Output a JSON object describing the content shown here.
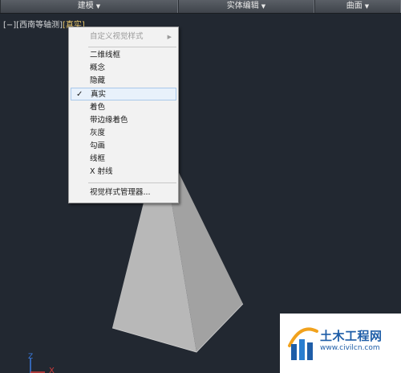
{
  "ribbon": {
    "tabs": [
      {
        "label": "建模",
        "arrow": "▼"
      },
      {
        "label": "实体编辑",
        "arrow": "▼"
      },
      {
        "label": "曲面",
        "arrow": "▼"
      }
    ]
  },
  "viewport": {
    "controls": "[−]",
    "view": "[西南等轴测]",
    "visual_style": "[真实]"
  },
  "context_menu": {
    "submenu_item": {
      "label": "自定义视觉样式",
      "arrow": "▶"
    },
    "styles": [
      {
        "label": "二维线框",
        "checked": false
      },
      {
        "label": "概念",
        "checked": false
      },
      {
        "label": "隐藏",
        "checked": false
      },
      {
        "label": "真实",
        "checked": true
      },
      {
        "label": "着色",
        "checked": false
      },
      {
        "label": "带边缘着色",
        "checked": false
      },
      {
        "label": "灰度",
        "checked": false
      },
      {
        "label": "勾画",
        "checked": false
      },
      {
        "label": "线框",
        "checked": false
      },
      {
        "label": "X 射线",
        "checked": false
      }
    ],
    "check_mark": "✓",
    "manager_item": "视觉样式管理器..."
  },
  "axis": {
    "z": "Z",
    "x": "X"
  },
  "watermark": {
    "brand": "土木工程网",
    "url": "www.civilcn.com",
    "accent": "#1f5ea8"
  },
  "colors": {
    "background": "#222831",
    "pyramid_light": "#b9b9b9",
    "pyramid_dark": "#9e9e9e",
    "active_label": "#e8c66a"
  }
}
